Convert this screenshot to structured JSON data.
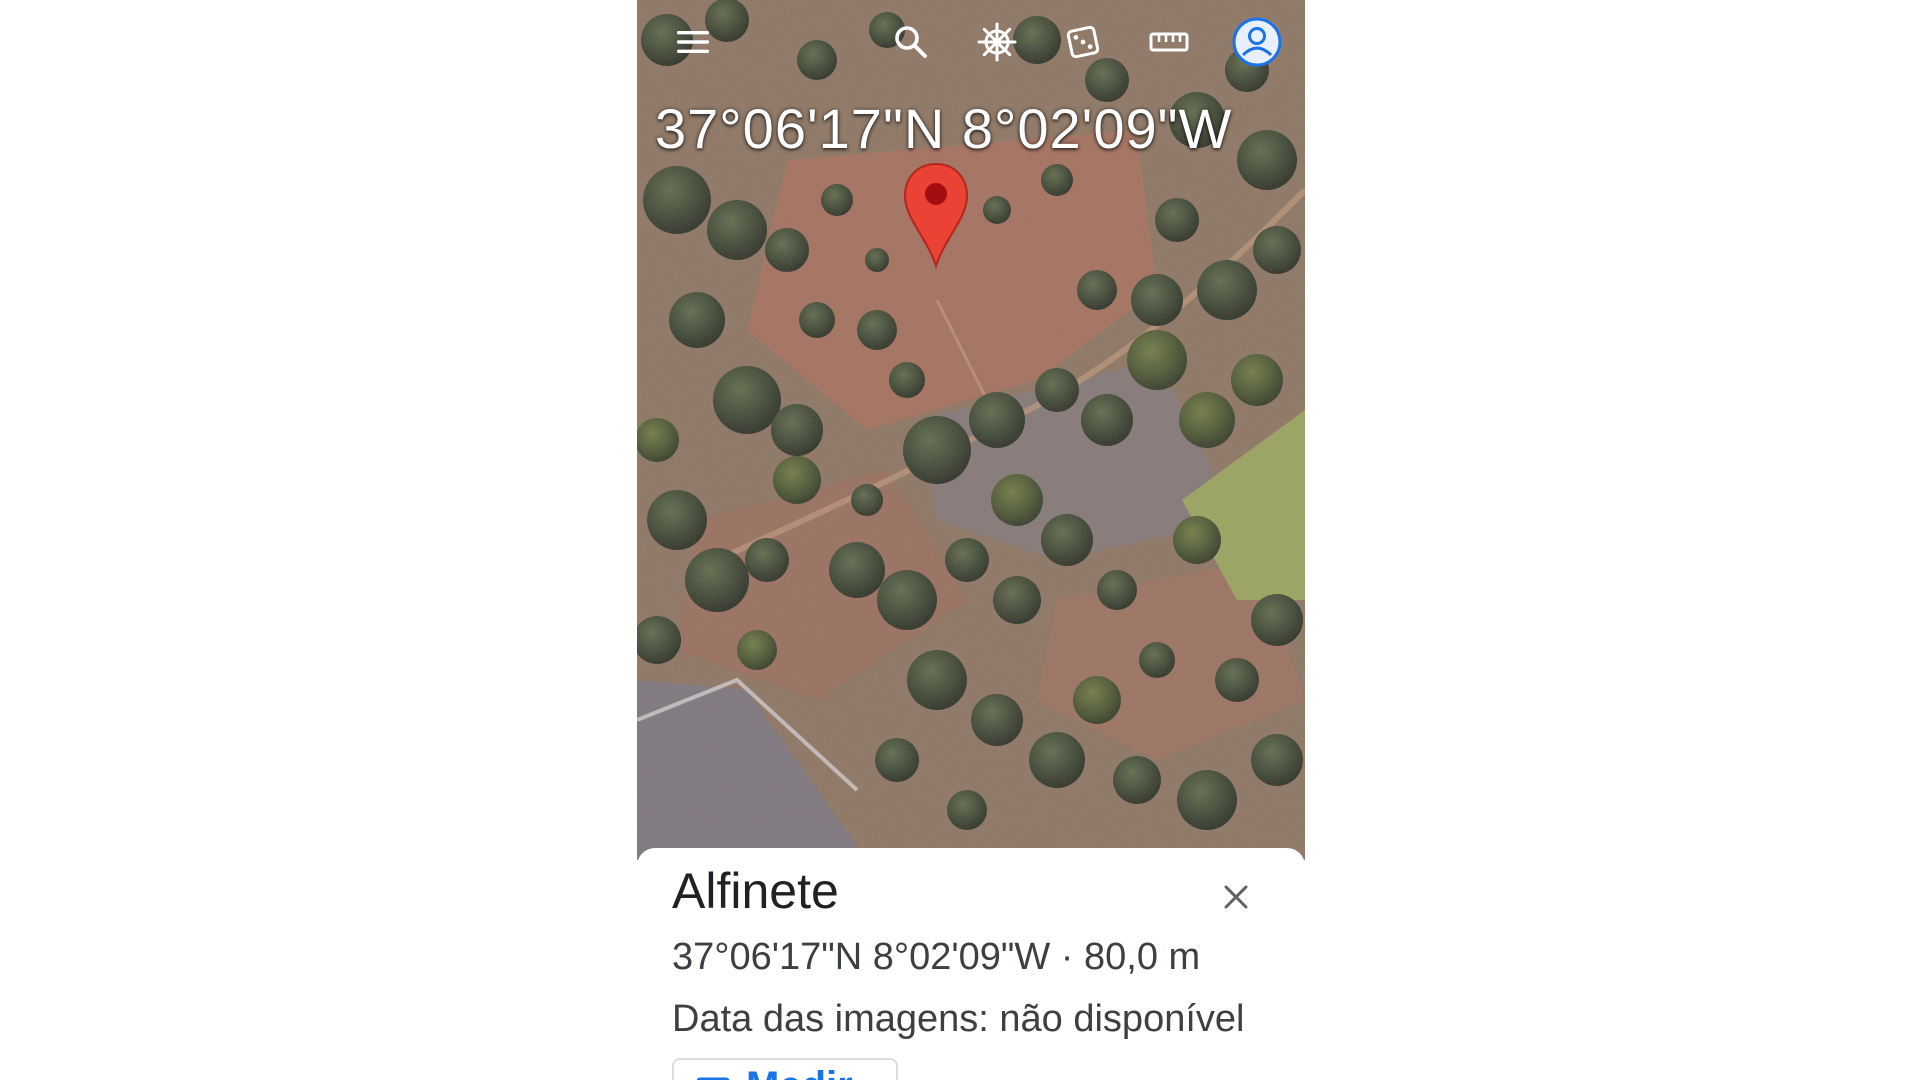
{
  "toolbar": {
    "icons": [
      "menu-icon",
      "search-icon",
      "voyager-helm-icon",
      "feeling-lucky-dice-icon",
      "measure-ruler-icon",
      "account-icon"
    ],
    "account_color": "#1a73e8"
  },
  "map": {
    "coordinates_overlay": "37°06'17\"N 8°02'09\"W",
    "pin_color": "#ea4335"
  },
  "sheet": {
    "title": "Alfinete",
    "coordinates": "37°06'17\"N 8°02'09\"W · 80,0 m",
    "imagery_date": "Data das imagens: não disponível",
    "measure_button": {
      "label": "Medir",
      "icon": "ruler-icon",
      "color": "#1a73e8"
    }
  }
}
